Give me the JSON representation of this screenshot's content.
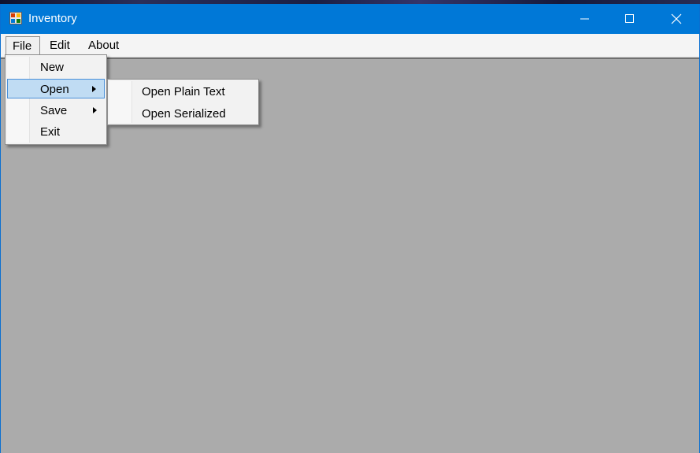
{
  "window": {
    "title": "Inventory",
    "title_bar_color": "#0078d7",
    "client_background": "#ababab",
    "icons": {
      "app": "app-form-icon",
      "minimize": "minimize-icon",
      "maximize": "maximize-icon",
      "close": "close-icon"
    }
  },
  "menubar": {
    "items": [
      {
        "label": "File",
        "state": "open"
      },
      {
        "label": "Edit"
      },
      {
        "label": "About"
      }
    ]
  },
  "file_menu": {
    "items": [
      {
        "label": "New",
        "has_submenu": false
      },
      {
        "label": "Open",
        "has_submenu": true,
        "highlighted": true
      },
      {
        "label": "Save",
        "has_submenu": true
      },
      {
        "label": "Exit",
        "has_submenu": false
      }
    ],
    "highlight_color": "#c0dcf3"
  },
  "open_submenu": {
    "items": [
      {
        "label": "Open Plain Text"
      },
      {
        "label": "Open Serialized"
      }
    ]
  }
}
